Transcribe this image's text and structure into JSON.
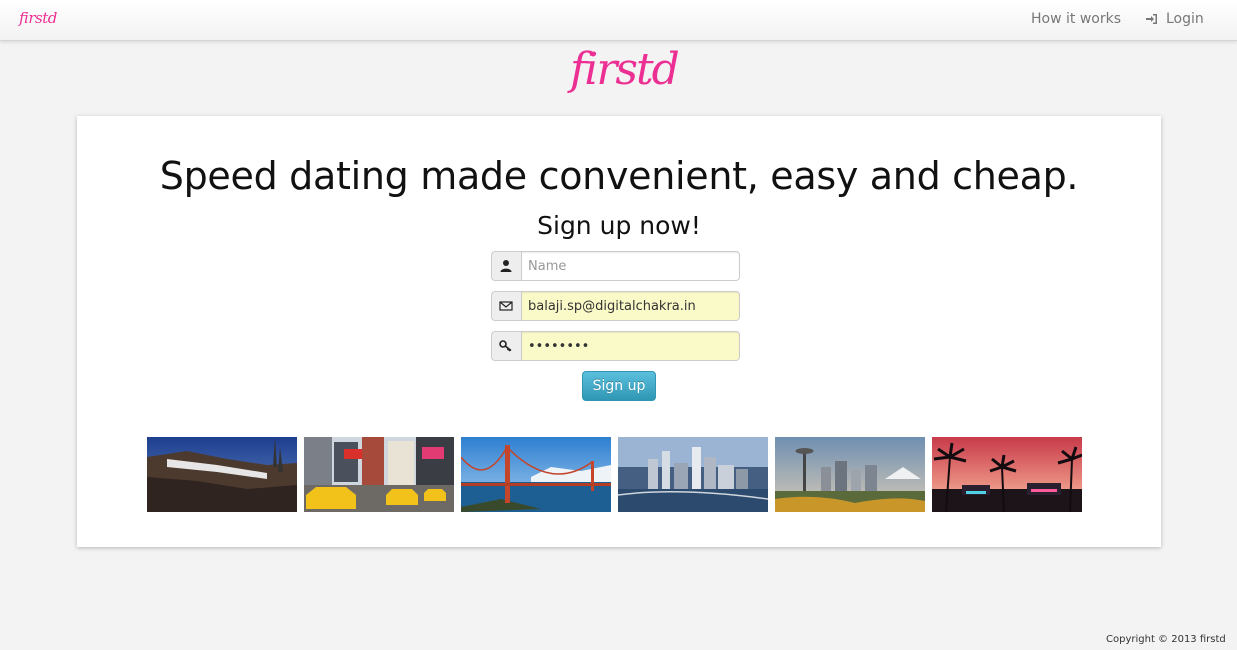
{
  "navbar": {
    "brand": "firstd",
    "links": [
      {
        "label": "How it works"
      },
      {
        "label": "Login",
        "icon": "login-icon"
      }
    ]
  },
  "logo": "firstd",
  "main": {
    "headline": "Speed dating made convenient, easy and cheap.",
    "subheadline": "Sign up now!"
  },
  "form": {
    "name": {
      "placeholder": "Name",
      "value": "",
      "icon": "user-icon"
    },
    "email": {
      "value": "balaji.sp@digitalchakra.in",
      "icon": "envelope-icon"
    },
    "password": {
      "value": "••••••••",
      "icon": "key-icon"
    },
    "submit_label": "Sign up"
  },
  "photos": [
    {
      "name": "hollywood-photo"
    },
    {
      "name": "new-york-taxi-photo"
    },
    {
      "name": "golden-gate-bridge-photo"
    },
    {
      "name": "city-skyline-photo"
    },
    {
      "name": "seattle-skyline-photo"
    },
    {
      "name": "miami-beach-photo"
    }
  ],
  "colors": {
    "brand_pink": "#ec2f93",
    "button_blue": "#2f96b4",
    "autofill_yellow": "#fafac8"
  },
  "footer": {
    "copyright": "Copyright © 2013 firstd"
  }
}
